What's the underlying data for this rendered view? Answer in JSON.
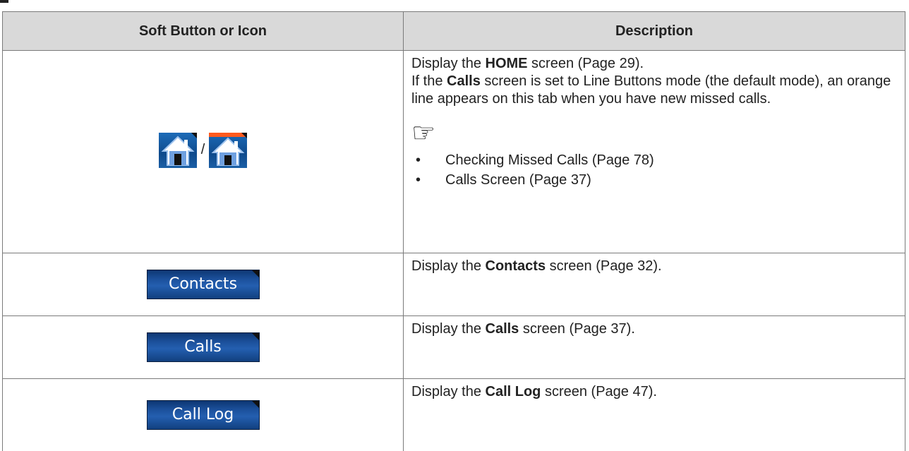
{
  "table": {
    "headers": [
      "Soft Button or Icon",
      "Description"
    ],
    "home_row": {
      "slash": "/",
      "desc_line1_pre": "Display the ",
      "desc_line1_bold": "HOME",
      "desc_line1_post": " screen (Page 29).",
      "desc_line2_pre": "If the ",
      "desc_line2_bold": "Calls",
      "desc_line2_post": " screen is set to Line Buttons mode (the default mode), an orange line appears on this tab when you have new missed calls.",
      "note_icon": "pointing-hand-icon",
      "references": [
        "Checking Missed Calls (Page 78)",
        "Calls Screen (Page 37)"
      ]
    },
    "rows": [
      {
        "button_label": "Contacts",
        "desc_pre": "Display the ",
        "desc_bold": "Contacts",
        "desc_post": " screen (Page 32)."
      },
      {
        "button_label": "Calls",
        "desc_pre": "Display the ",
        "desc_bold": "Calls",
        "desc_post": " screen (Page 37)."
      },
      {
        "button_label": "Call Log",
        "desc_pre": "Display the ",
        "desc_bold": "Call Log",
        "desc_post": " screen (Page 47)."
      }
    ]
  },
  "colors": {
    "header_bg": "#d9d9d9",
    "button_blue": "#1b4f9a",
    "missed_line_orange": "#ff5a1e"
  }
}
